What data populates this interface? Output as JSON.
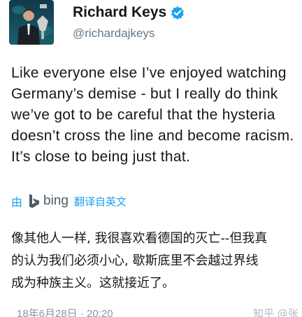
{
  "author": {
    "display_name": "Richard Keys",
    "handle": "@richardajkeys",
    "verified": true,
    "avatar_icon": "user-photo-avatar"
  },
  "tweet": {
    "lines": [
      "Like everyone else I’ve enjoyed watching",
      "Germany’s demise - but I really do think",
      "we’ve got to be careful that the hysteria",
      "doesn’t cross the line and become racism.",
      "It’s close to being just that."
    ]
  },
  "translation": {
    "by_label": "由",
    "provider": "bing",
    "translated_from": "翻译自英文",
    "lines": [
      "像其他人一样, 我很喜欢看德国的灭亡--但我真",
      "的认为我们必须小心, 歇斯底里不会越过界线",
      "成为种族主义。这就接近了。"
    ]
  },
  "footer": {
    "timestamp": "18年6月28日 · 20:20",
    "watermark": "知乎 @张"
  },
  "colors": {
    "accent": "#1da1f2",
    "text": "#14171a",
    "muted": "#657786",
    "bing": "#4c5a66"
  }
}
